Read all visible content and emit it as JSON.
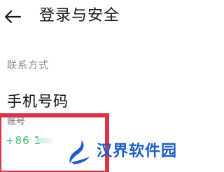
{
  "header": {
    "back_icon": "arrow-left-icon",
    "title": "登录与安全"
  },
  "contact_section": {
    "header": "联系方式",
    "phone": {
      "title": "手机号码",
      "label": "账号",
      "value": "+86 1"
    }
  },
  "watermark": {
    "text": "汉界软件园",
    "color": "#1e5dc9"
  },
  "colors": {
    "highlight": "#d8344a",
    "phone_value": "#3db86b",
    "section_header": "#8c8c8c"
  }
}
